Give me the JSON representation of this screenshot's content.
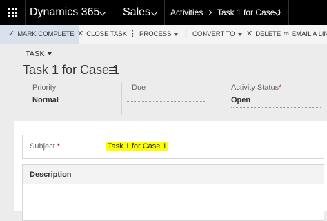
{
  "topbar": {
    "app_name": "Dynamics 365",
    "module": "Sales",
    "area": "Activities",
    "breadcrumb_record": "Task 1 for Case 1"
  },
  "commands": {
    "mark_complete": "MARK COMPLETE",
    "close_task": "CLOSE TASK",
    "process": "PROCESS",
    "convert_to": "CONVERT TO",
    "delete": "DELETE",
    "email_link": "EMAIL A LIN"
  },
  "header": {
    "entity_type": "TASK",
    "record_title": "Task 1 for Case 1",
    "fields": [
      {
        "label": "Priority",
        "value": "Normal"
      },
      {
        "label": "Due",
        "value": ""
      },
      {
        "label": "Activity Status",
        "value": "Open"
      }
    ]
  },
  "form": {
    "subject_label": "Subject",
    "subject_value": "Task 1 for Case 1",
    "description_label": "Description"
  },
  "colors": {
    "topbar_bg": "#000000",
    "highlight": "#ffff00",
    "required": "#cc0000"
  }
}
